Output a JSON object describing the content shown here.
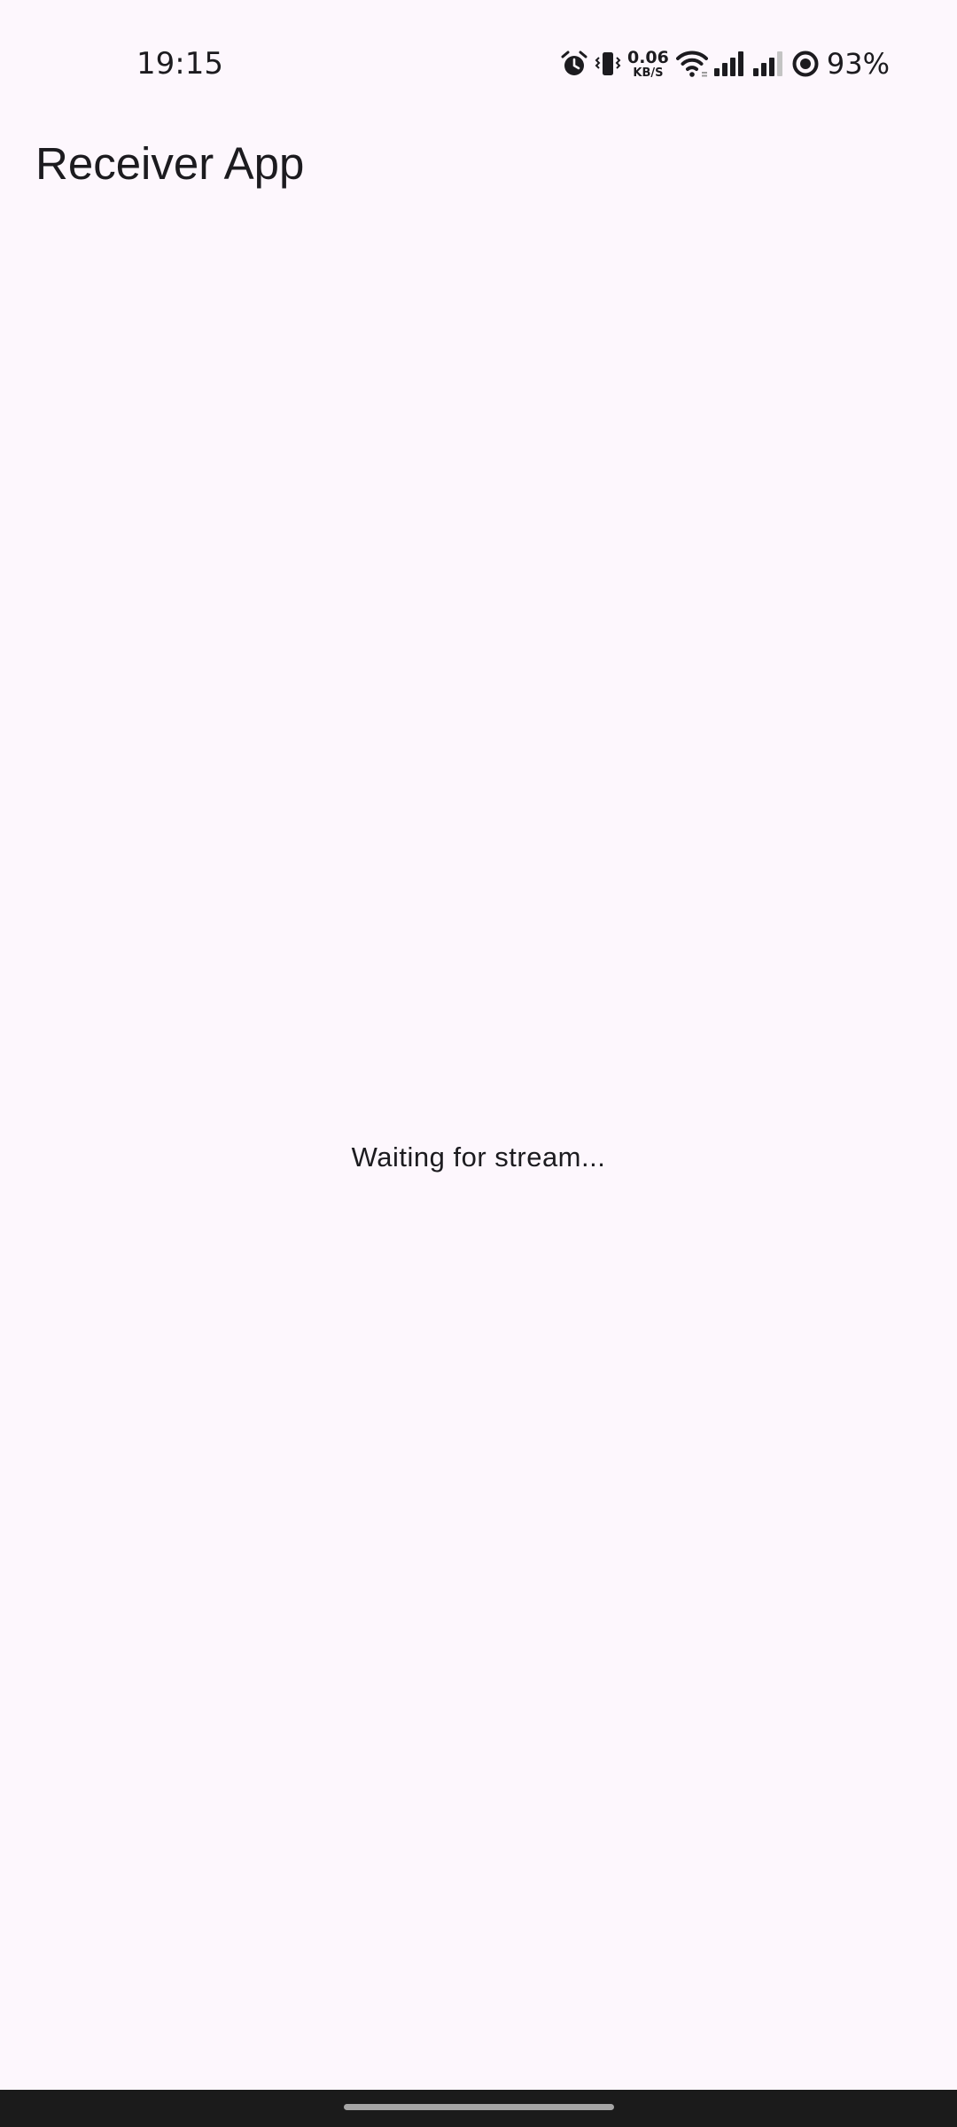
{
  "status_bar": {
    "time": "19:15",
    "net_speed_value": "0.06",
    "net_speed_unit": "KB/S",
    "battery": "93%",
    "icons": [
      "alarm-icon",
      "vibrate-icon",
      "wifi-icon",
      "signal-icon-sim1",
      "signal-icon-sim2",
      "battery-ring-icon"
    ]
  },
  "app_bar": {
    "title": "Receiver App"
  },
  "main": {
    "status_message": "Waiting for stream..."
  },
  "colors": {
    "background": "#fdf7fd",
    "text": "#1c1b1f",
    "nav_bar": "#1b1b1b",
    "nav_handle": "#a5a5a5"
  }
}
